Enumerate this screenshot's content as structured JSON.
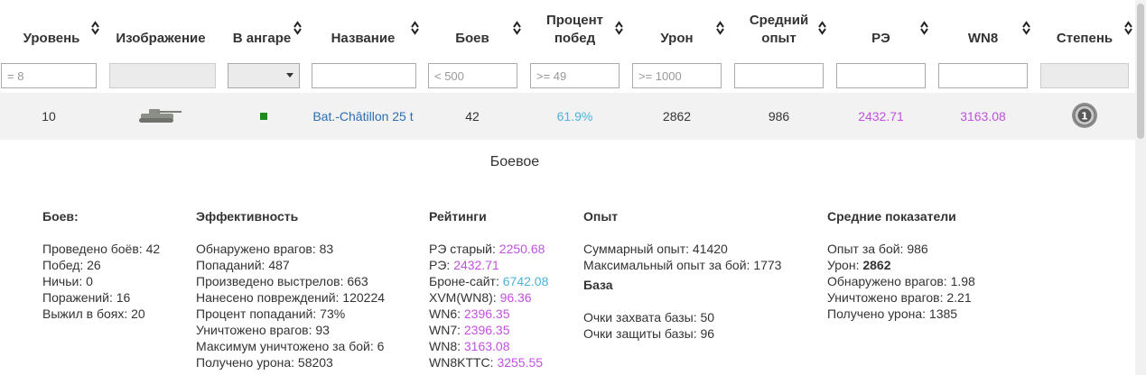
{
  "columns": [
    {
      "key": "level",
      "label": "Уровень"
    },
    {
      "key": "image",
      "label": "Изображение"
    },
    {
      "key": "garage",
      "label": "В ангаре"
    },
    {
      "key": "name",
      "label": "Название"
    },
    {
      "key": "battles",
      "label": "Боев"
    },
    {
      "key": "winrate",
      "label": "Процент\nпобед"
    },
    {
      "key": "damage",
      "label": "Урон"
    },
    {
      "key": "avg_xp",
      "label": "Средний\nопыт"
    },
    {
      "key": "re",
      "label": "РЭ"
    },
    {
      "key": "wn8",
      "label": "WN8"
    },
    {
      "key": "mastery",
      "label": "Степень"
    }
  ],
  "filters": {
    "level_placeholder": "= 8",
    "battles_placeholder": "< 500",
    "winrate_placeholder": ">= 49",
    "damage_placeholder": ">= 1000",
    "avg_xp_value": "",
    "re_value": "",
    "wn8_value": "",
    "name_value": ""
  },
  "row": {
    "level": "10",
    "garage_status": "in-garage",
    "name": "Bat.-Châtillon 25 t",
    "battles": "42",
    "winrate": "61.9%",
    "damage": "2862",
    "avg_xp": "986",
    "re": "2432.71",
    "wn8": "3163.08",
    "mastery_badge": "1"
  },
  "colors": {
    "link": "#2a6fb5",
    "cyan": "#4cb3d9",
    "violet": "#c151e0",
    "garage": "#1f8a1f"
  },
  "icons": {
    "sort": "sort-arrows-icon",
    "tank": "tank-icon",
    "mastery": "mastery-badge-icon"
  },
  "detail": {
    "title": "Боевое",
    "battles": {
      "header": "Боев:",
      "lines": [
        "Проведено боёв: 42",
        "Побед: 26",
        "Ничьи: 0",
        "Поражений: 16",
        "Выжил в боях: 20"
      ]
    },
    "efficiency": {
      "header": "Эффективность",
      "lines": [
        "Обнаружено врагов: 83",
        "Попаданий: 487",
        "Произведено выстрелов: 663",
        "Нанесено повреждений: 120224",
        "Процент попаданий: 73%",
        "Уничтожено врагов: 93",
        "Максимум уничтожено за бой: 6",
        "Получено урона: 58203"
      ]
    },
    "ratings": {
      "header": "Рейтинги",
      "items": [
        {
          "label": "РЭ старый: ",
          "value": "2250.68",
          "color": "violet"
        },
        {
          "label": "РЭ: ",
          "value": "2432.71",
          "color": "violet"
        },
        {
          "label": "Броне-сайт: ",
          "value": "6742.08",
          "color": "cyan"
        },
        {
          "label": "XVM(WN8): ",
          "value": "96.36",
          "color": "violet"
        },
        {
          "label": "WN6: ",
          "value": "2396.35",
          "color": "violet"
        },
        {
          "label": "WN7: ",
          "value": "2396.35",
          "color": "violet"
        },
        {
          "label": "WN8: ",
          "value": "3163.08",
          "color": "violet"
        },
        {
          "label": "WN8KTTC: ",
          "value": "3255.55",
          "color": "violet"
        }
      ]
    },
    "experience": {
      "header": "Опыт",
      "lines": [
        "Суммарный опыт: 41420",
        "Максимальный опыт за бой: 1773"
      ],
      "base_header": "База",
      "base_lines": [
        "Очки захвата базы: 50",
        "Очки защиты базы: 96"
      ]
    },
    "averages": {
      "header": "Средние показатели",
      "xp": "Опыт за бой: 986",
      "damage_label": "Урон: ",
      "damage_value": "2862",
      "lines": [
        "Обнаружено врагов: 1.98",
        "Уничтожено врагов: 2.21",
        "Получено урона: 1385"
      ]
    }
  }
}
